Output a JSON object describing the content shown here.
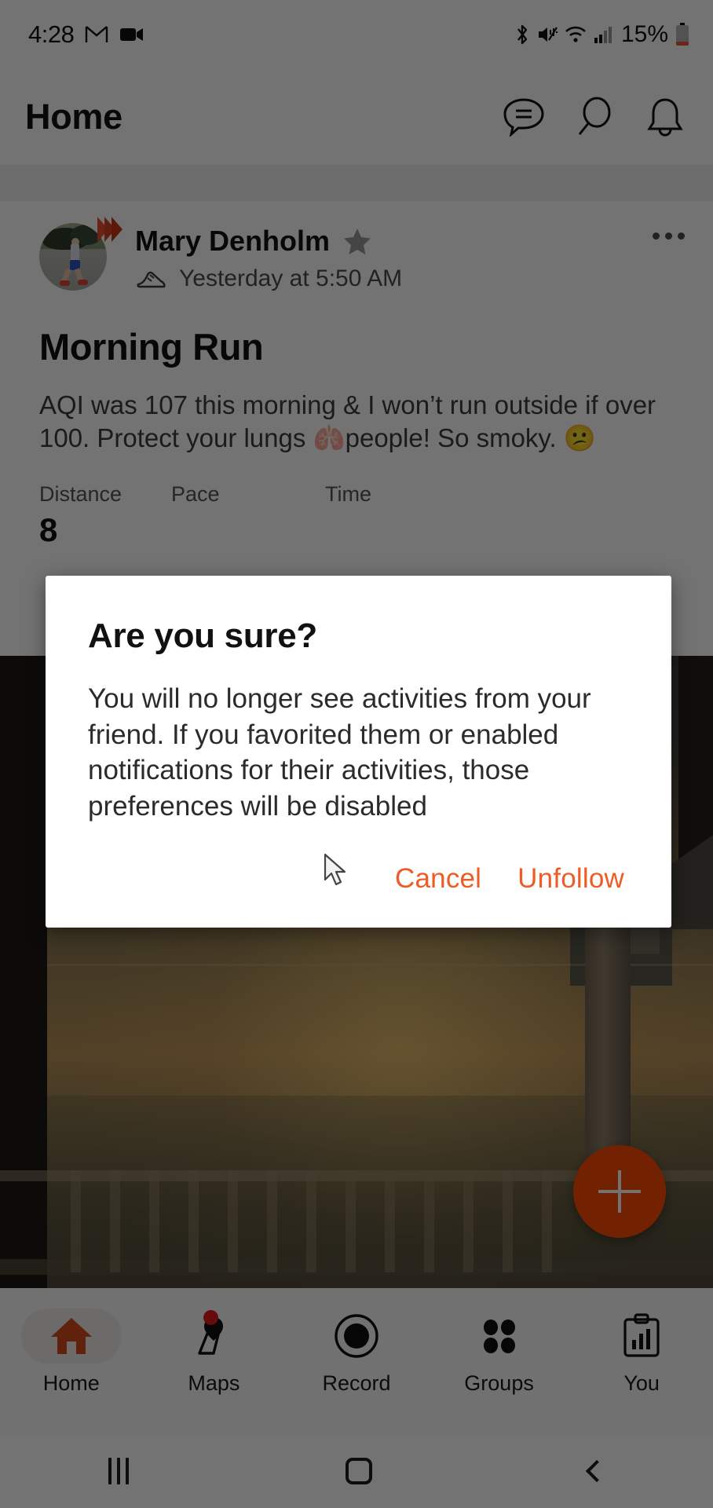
{
  "status_bar": {
    "time": "4:28",
    "battery_percent": "15%",
    "icons": [
      "gmail-icon",
      "video-camera-icon",
      "bluetooth-icon",
      "mute-icon",
      "wifi-icon",
      "cellular-signal-icon",
      "battery-icon"
    ]
  },
  "app_bar": {
    "title": "Home",
    "actions": [
      "messages-icon",
      "search-icon",
      "notifications-bell-icon"
    ]
  },
  "post": {
    "author": "Mary Denholm",
    "favorite_marked": true,
    "activity_type_icon": "running-shoe-icon",
    "timestamp": "Yesterday at 5:50 AM",
    "title": "Morning Run",
    "body": "AQI was 107 this morning & I won’t run outside if over 100. Protect your lungs 🫁people! So smoky. 😕",
    "overflow_menu": "more-options-icon",
    "stats": [
      {
        "label": "Distance",
        "value": "8"
      },
      {
        "label": "Pace",
        "value": ""
      },
      {
        "label": "Time",
        "value": ""
      }
    ]
  },
  "fab": {
    "icon": "plus-icon"
  },
  "bottom_nav": {
    "items": [
      {
        "label": "Home",
        "icon": "home-icon",
        "active": true,
        "badge": false
      },
      {
        "label": "Maps",
        "icon": "map-pin-icon",
        "active": false,
        "badge": true
      },
      {
        "label": "Record",
        "icon": "record-icon",
        "active": false,
        "badge": false
      },
      {
        "label": "Groups",
        "icon": "groups-dots-icon",
        "active": false,
        "badge": false
      },
      {
        "label": "You",
        "icon": "clipboard-chart-icon",
        "active": false,
        "badge": false
      }
    ]
  },
  "system_nav": {
    "recent_label": "recent-apps-icon",
    "home_label": "system-home-icon",
    "back_label": "system-back-icon"
  },
  "dialog": {
    "title": "Are you sure?",
    "body": "You will no longer see activities from your friend. If you favorited them or enabled notifications for their activities, those preferences will be disabled",
    "cancel_label": "Cancel",
    "confirm_label": "Unfollow"
  },
  "colors": {
    "accent_orange": "#fc4c02",
    "dialog_action": "#ef5b25",
    "badge_red": "#e31b1b",
    "scrim": "rgba(0,0,0,0.55)"
  }
}
